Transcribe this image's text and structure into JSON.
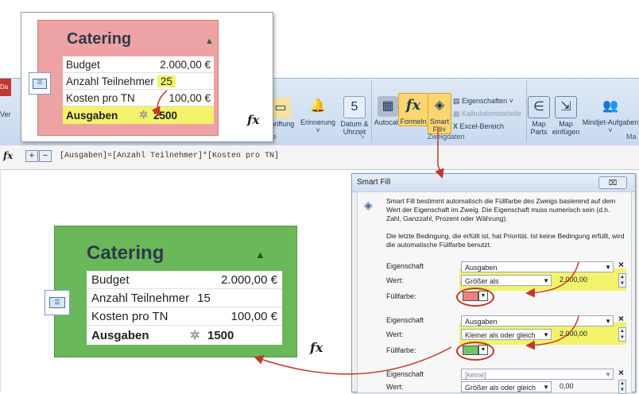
{
  "top_tab": "Da",
  "left_clip": "Ver",
  "ribbon": {
    "buttons": [
      {
        "label": "chriftung",
        "icon": "label-icon"
      },
      {
        "label": "Erinnerung",
        "icon": "bell-icon"
      },
      {
        "label": "Datum &",
        "label2": "Uhrzeit",
        "icon": "calendar-icon"
      },
      {
        "label": "Autocalc",
        "icon": "calculator-icon"
      },
      {
        "label": "Formeln",
        "icon": "fx-icon"
      },
      {
        "label": "Smart",
        "label2": "Fill",
        "icon": "paint-bucket-icon"
      },
      {
        "label": "Map",
        "label2": "Parts",
        "icon": "map-parts-icon"
      },
      {
        "label": "Map",
        "label2": "einfügen",
        "icon": "map-insert-icon"
      },
      {
        "label": "Mindjet-Aufgaben",
        "icon": "people-icon"
      }
    ],
    "side_items": [
      "Eigenschaften",
      "Kalkulationstabelle",
      "Excel-Bereich"
    ],
    "group_labels": [
      "te",
      "Zweigdaten",
      "Ma"
    ]
  },
  "formula": "[Ausgaben]=[Anzahl Teilnehmer]*[Kosten pro TN]",
  "fx": "fx",
  "card_red": {
    "title": "Catering",
    "rows": [
      {
        "label": "Budget",
        "value": "2.000,00 €"
      },
      {
        "label": "Anzahl Teilnehmer",
        "value": "25"
      },
      {
        "label": "Kosten pro TN",
        "value": "100,00 €"
      },
      {
        "label": "Ausgaben",
        "value": "2500"
      }
    ]
  },
  "card_green": {
    "title": "Catering",
    "rows": [
      {
        "label": "Budget",
        "value": "2.000,00 €"
      },
      {
        "label": "Anzahl Teilnehmer",
        "value": "15"
      },
      {
        "label": "Kosten pro TN",
        "value": "100,00 €"
      },
      {
        "label": "Ausgaben",
        "value": "1500"
      }
    ]
  },
  "dialog": {
    "title": "Smart Fill",
    "desc": "Smart Fill bestimmt automatisch die Füllfarbe des Zweigs basierend auf dem Wert der Eigenschaft im Zweig. Die Eigenschaft muss numerisch sein (d.h. Zahl, Ganzzahl, Prozent oder Währung).",
    "note": "Die letzte Bedingung, die erfüllt ist, hat Priorität. Ist keine Bedingung erfüllt, wird die automatische Füllfarbe benutzt.",
    "lbl_prop": "Eigenschaft",
    "lbl_val": "Wert:",
    "lbl_fill": "Füllfarbe:",
    "conds": [
      {
        "prop": "Ausgaben",
        "op": "Größer als",
        "num": "2.000,00",
        "fill": "#f08080"
      },
      {
        "prop": "Ausgaben",
        "op": "Kleiner als oder gleich",
        "num": "2.000,00",
        "fill": "#74c26a"
      },
      {
        "prop": "[keine]",
        "op": "Größer als oder gleich",
        "num": "0,00"
      }
    ]
  },
  "colors": {
    "red_card": "#eda3a3",
    "green_card": "#6ab85a",
    "highlight": "#f2f26b",
    "arrow": "#c0392b"
  }
}
